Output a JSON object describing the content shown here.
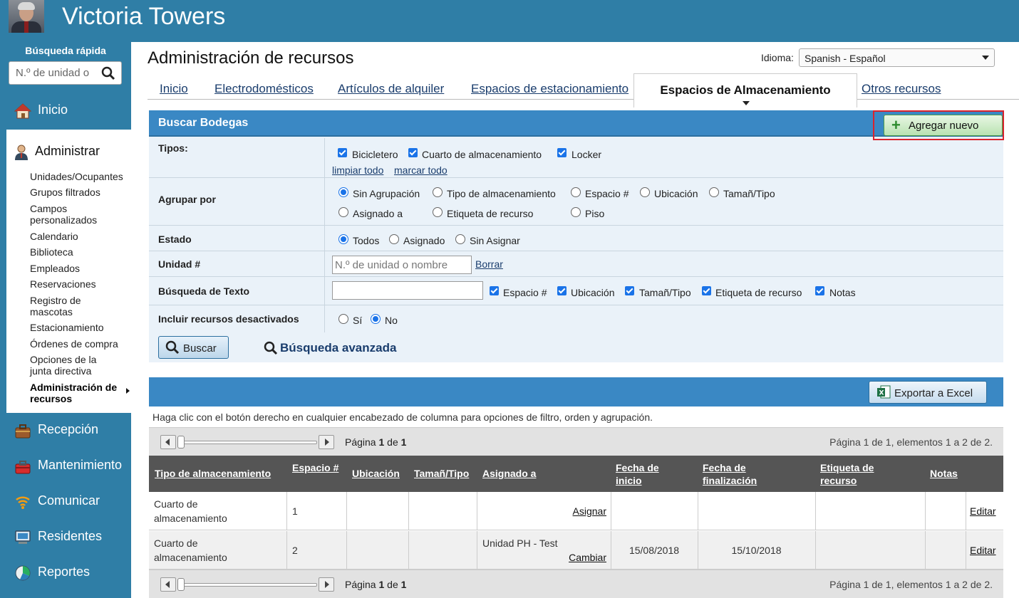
{
  "header": {
    "title": "Victoria Towers"
  },
  "sidebar": {
    "quick_search_label": "Búsqueda rápida",
    "quick_search_placeholder": "N.º de unidad o",
    "nav": {
      "inicio": "Inicio",
      "administrar": "Administrar",
      "recepcion": "Recepción",
      "mantenimiento": "Mantenimiento",
      "comunicar": "Comunicar",
      "residentes": "Residentes",
      "reportes": "Reportes"
    },
    "admin_items": [
      "Unidades/Ocupantes",
      "Grupos filtrados",
      "Campos personalizados",
      "Calendario",
      "Biblioteca",
      "Empleados",
      "Reservaciones",
      "Registro de mascotas",
      "Estacionamiento",
      "Órdenes de compra",
      "Opciones de la junta directiva",
      "Administración de recursos"
    ]
  },
  "page": {
    "title": "Administración de recursos",
    "language_label": "Idioma:",
    "language_value": "Spanish - Español"
  },
  "tabs": {
    "inicio": "Inicio",
    "electro": "Electrodomésticos",
    "alquiler": "Artículos de alquiler",
    "estacionamiento": "Espacios de estacionamiento",
    "almacenamiento": "Espacios de Almacenamiento",
    "otros": "Otros recursos"
  },
  "search": {
    "panel_title": "Buscar Bodegas",
    "add_new": "Agregar nuevo",
    "tipos_label": "Tipos:",
    "tipos": [
      "Bicicletero",
      "Cuarto de almacenamiento",
      "Locker"
    ],
    "limpiar": "limpiar todo",
    "marcar": "marcar todo",
    "agrupar_label": "Agrupar por",
    "agrupar": [
      "Sin Agrupación",
      "Tipo de almacenamiento",
      "Espacio #",
      "Ubicación",
      "Tamañ/Tipo",
      "Asignado a",
      "Etiqueta de recurso",
      "Piso"
    ],
    "estado_label": "Estado",
    "estado": [
      "Todos",
      "Asignado",
      "Sin Asignar"
    ],
    "unidad_label": "Unidad #",
    "unidad_placeholder": "N.º de unidad o nombre",
    "borrar": "Borrar",
    "texto_label": "Búsqueda de Texto",
    "texto_fields": [
      "Espacio #",
      "Ubicación",
      "Tamañ/Tipo",
      "Etiqueta de recurso",
      "Notas"
    ],
    "incluir_label": "Incluir recursos desactivados",
    "incluir": [
      "Sí",
      "No"
    ],
    "buscar": "Buscar",
    "avanzada": "Búsqueda avanzada"
  },
  "results": {
    "export": "Exportar a Excel",
    "hint": "Haga clic con el botón derecho en cualquier encabezado de columna para opciones de filtro, orden y agrupación.",
    "pager": {
      "pagina": "Página",
      "num": "1",
      "de": "de",
      "total": "1",
      "summary": "Página 1 de 1, elementos 1 a 2 de 2."
    },
    "columns": [
      "Tipo de almacenamiento",
      "Espacio #",
      "Ubicación",
      "Tamañ/Tipo",
      "Asignado a",
      "Fecha de inicio",
      "Fecha de finalización",
      "Etiqueta de recurso",
      "Notas"
    ],
    "rows": [
      {
        "tipo": "Cuarto de almacenamiento",
        "espacio": "1",
        "asignado": "",
        "accion": "Asignar",
        "inicio": "",
        "fin": "",
        "editar": "Editar"
      },
      {
        "tipo": "Cuarto de almacenamiento",
        "espacio": "2",
        "asignado": "Unidad PH - Test",
        "accion": "Cambiar",
        "inicio": "15/08/2018",
        "fin": "15/10/2018",
        "editar": "Editar"
      }
    ]
  },
  "colors": {
    "brand": "#2f7ea6",
    "panel_header": "#3a88c4",
    "table_header": "#555555",
    "highlight": "#d9232d"
  }
}
